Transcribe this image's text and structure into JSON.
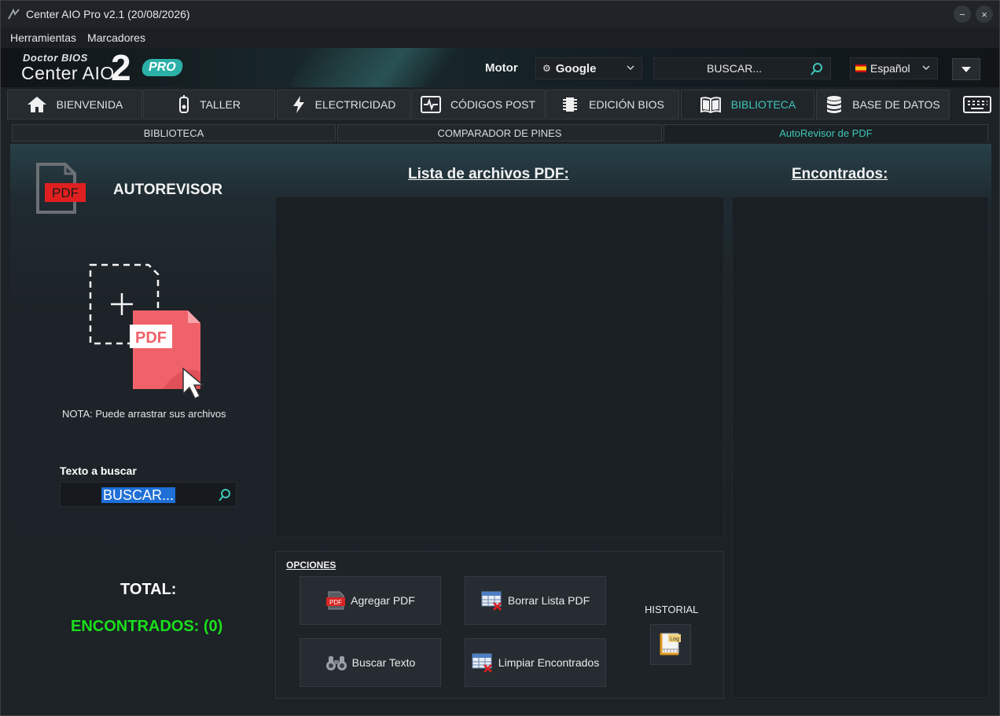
{
  "window": {
    "title": "Center AIO Pro v2.1 (20/08/2026)",
    "minimize_label": "−",
    "close_label": "×"
  },
  "menu": {
    "items": [
      "Herramientas",
      "Marcadores"
    ]
  },
  "header": {
    "logo_small": "Doctor BIOS",
    "logo_main": "Center AIO",
    "logo_number": "2",
    "logo_badge": "PRO",
    "motor_label": "Motor",
    "engine_value": "Google",
    "search_placeholder": "BUSCAR...",
    "language_value": "Español"
  },
  "tabs": [
    {
      "label": "BIENVENIDA",
      "icon": "home-icon"
    },
    {
      "label": "TALLER",
      "icon": "multimeter-icon"
    },
    {
      "label": "ELECTRICIDAD",
      "icon": "lightning-icon"
    },
    {
      "label": "CÓDIGOS POST",
      "icon": "post-card-icon"
    },
    {
      "label": "EDICIÓN BIOS",
      "icon": "chip-icon"
    },
    {
      "label": "BIBLIOTECA",
      "icon": "book-icon",
      "active": true
    },
    {
      "label": "BASE DE DATOS",
      "icon": "database-icon"
    }
  ],
  "subtabs": [
    {
      "label": "BIBLIOTECA"
    },
    {
      "label": "COMPARADOR DE PINES"
    },
    {
      "label": "AutoRevisor de PDF",
      "active": true
    }
  ],
  "left_panel": {
    "heading": "AUTOREVISOR",
    "pdf_badge": "PDF",
    "drop_badge": "PDF",
    "note": "NOTA: Puede arrastrar sus archivos",
    "search_label": "Texto a buscar",
    "search_value": "BUSCAR...",
    "total_label": "TOTAL:",
    "found_count": "ENCONTRADOS: (0)"
  },
  "pdf_list": {
    "title": "Lista de archivos PDF:"
  },
  "found_list": {
    "title": "Encontrados:"
  },
  "options": {
    "label": "OPCIONES",
    "add_pdf": "Agregar PDF",
    "clear_list": "Borrar Lista PDF",
    "search_text": "Buscar Texto",
    "clear_found": "Limpiar Encontrados",
    "history_label": "HISTORIAL",
    "log_badge": "Log"
  },
  "colors": {
    "accent": "#3ec6b8",
    "found_green": "#19e01b",
    "pdf_red": "#e35a62"
  }
}
